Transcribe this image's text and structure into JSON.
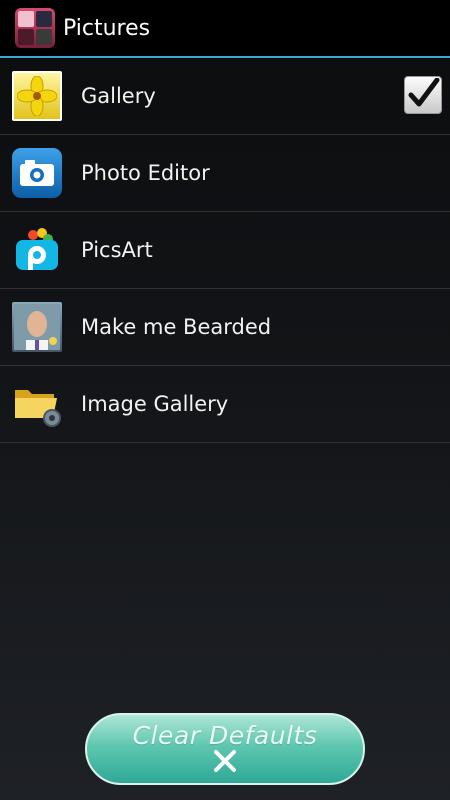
{
  "header": {
    "title": "Pictures"
  },
  "apps": [
    {
      "label": "Gallery",
      "icon": "flower-photo-icon",
      "checked": true
    },
    {
      "label": "Photo Editor",
      "icon": "camera-icon",
      "checked": false
    },
    {
      "label": "PicsArt",
      "icon": "picsart-logo-icon",
      "checked": false
    },
    {
      "label": "Make me Bearded",
      "icon": "bearded-face-icon",
      "checked": false
    },
    {
      "label": "Image Gallery",
      "icon": "folder-gear-icon",
      "checked": false
    }
  ],
  "clear_button": {
    "label": "Clear Defaults",
    "icon": "close-icon"
  },
  "colors": {
    "accent": "#3aa7d6",
    "button": "#5fc7b0"
  }
}
